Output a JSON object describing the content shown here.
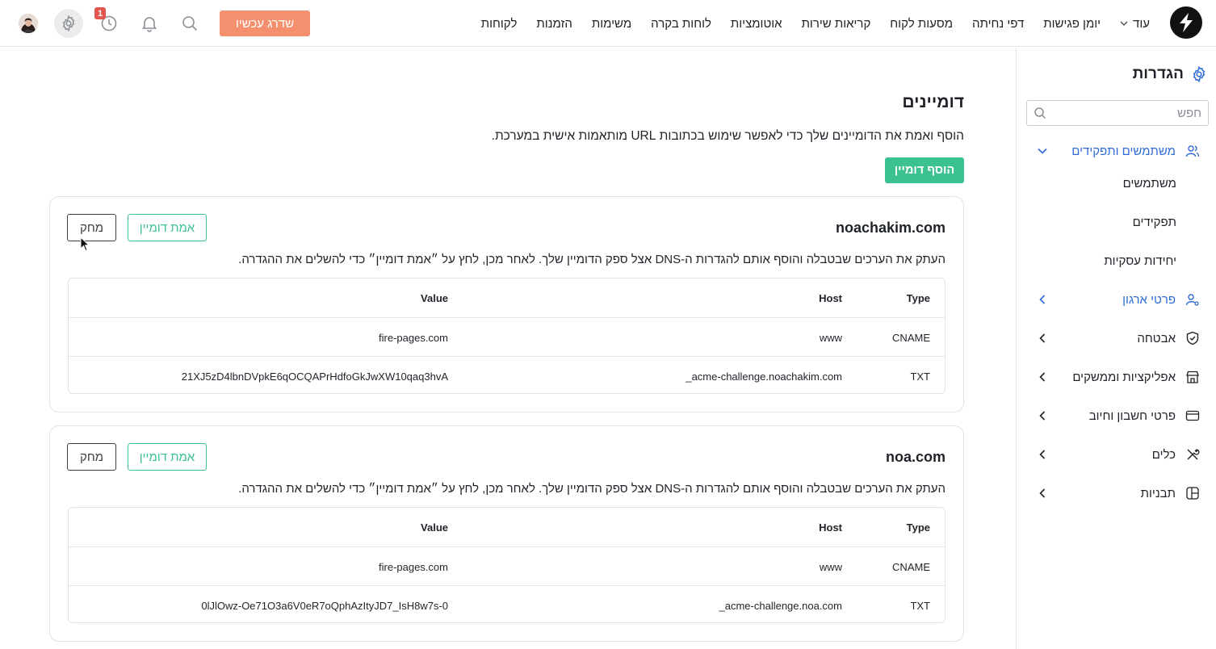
{
  "topbar": {
    "nav": [
      "לקוחות",
      "הזמנות",
      "משימות",
      "לוחות בקרה",
      "אוטומציות",
      "קריאות שירות",
      "מסעות לקוח",
      "דפי נחיתה",
      "יומן פגישות"
    ],
    "more_label": "עוד",
    "upgrade_label": "שדרג עכשיו",
    "notification_badge": "1",
    "icons": [
      "search-icon",
      "bell-icon",
      "history-icon",
      "gear-icon"
    ]
  },
  "sidebar": {
    "title": "הגדרות",
    "search_placeholder": "חפש",
    "sections": [
      {
        "label": "משתמשים ותפקידים",
        "icon": "users-icon",
        "expanded": true,
        "children": [
          "משתמשים",
          "תפקידים",
          "יחידות עסקיות"
        ]
      },
      {
        "label": "פרטי ארגון",
        "icon": "org-user-icon",
        "expanded": false
      },
      {
        "label": "אבטחה",
        "icon": "shield-icon",
        "expanded": false
      },
      {
        "label": "אפליקציות וממשקים",
        "icon": "store-icon",
        "expanded": false
      },
      {
        "label": "פרטי חשבון וחיוב",
        "icon": "credit-card-icon",
        "expanded": false
      },
      {
        "label": "כלים",
        "icon": "tools-icon",
        "expanded": false
      },
      {
        "label": "תבניות",
        "icon": "template-icon",
        "expanded": false
      }
    ]
  },
  "main": {
    "title": "דומיינים",
    "description": "הוסף ואמת את הדומיינים שלך כדי לאפשר שימוש בכתובות URL מותאמות אישית במערכת.",
    "add_button": "הוסף דומיין",
    "columns": {
      "type": "Type",
      "host": "Host",
      "value": "Value"
    },
    "domains": [
      {
        "name": "noachakim.com",
        "verify_label": "אמת דומיין",
        "delete_label": "מחק",
        "instructions": "העתק את הערכים שבטבלה והוסף אותם להגדרות ה-DNS אצל ספק הדומיין שלך. לאחר מכן, לחץ על ״אמת דומיין״ כדי להשלים את ההגדרה.",
        "records": [
          {
            "type": "CNAME",
            "host": "www",
            "value": "fire-pages.com"
          },
          {
            "type": "TXT",
            "host": "_acme-challenge.noachakim.com",
            "value": "21XJ5zD4lbnDVpkE6qOCQAPrHdfoGkJwXW10qaq3hvA"
          }
        ]
      },
      {
        "name": "noa.com",
        "verify_label": "אמת דומיין",
        "delete_label": "מחק",
        "instructions": "העתק את הערכים שבטבלה והוסף אותם להגדרות ה-DNS אצל ספק הדומיין שלך. לאחר מכן, לחץ על ״אמת דומיין״ כדי להשלים את ההגדרה.",
        "records": [
          {
            "type": "CNAME",
            "host": "www",
            "value": "fire-pages.com"
          },
          {
            "type": "TXT",
            "host": "_acme-challenge.noa.com",
            "value": "0lJlOwz-Oe71O3a6V0eR7oQphAzItyJD7_IsH8w7s-0"
          }
        ]
      }
    ]
  },
  "colors": {
    "accent_green": "#3cc191",
    "upgrade_orange": "#f5906f",
    "link_blue": "#2f6bd8",
    "badge_red": "#e2564f"
  }
}
